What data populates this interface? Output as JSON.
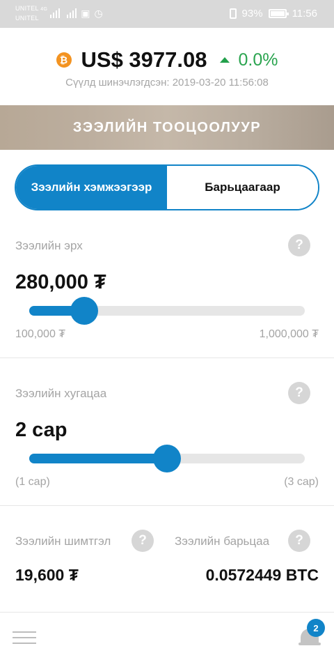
{
  "status_bar": {
    "carrier_1": "UNITEL",
    "carrier_1_tech": "4G",
    "carrier_2": "UNITEL",
    "battery": "93%",
    "time": "11:56"
  },
  "header": {
    "currency_icon": "bitcoin-icon",
    "price": "US$ 3977.08",
    "change": "0.0%",
    "trend_icon": "arrow-up-icon",
    "updated": "Сүүлд шинэчлэгдсэн: 2019-03-20 11:56:08",
    "colors": {
      "bitcoin": "#f39321",
      "positive": "#2aa44f"
    }
  },
  "banner": {
    "title": "ЗЭЭЛИЙН ТООЦООЛУУР"
  },
  "toggle": {
    "option_1": "Зээлийн хэмжээгээр",
    "option_2": "Барьцаагаар",
    "selected": "Зээлийн хэмжээгээр"
  },
  "loan_amount": {
    "label": "Зээлийн эрх",
    "value": "280,000 ₮",
    "min": "100,000 ₮",
    "max": "1,000,000 ₮",
    "fraction": 0.2
  },
  "loan_term": {
    "label": "Зээлийн хугацаа",
    "value": "2 сар",
    "min": "(1 сар)",
    "max": "(3 сар)",
    "fraction": 0.5
  },
  "summary": {
    "fee_label": "Зээлийн шимтгэл",
    "fee_value": "19,600 ₮",
    "collateral_label": "Зээлийн барьцаа",
    "collateral_value": "0.0572449 BTC"
  },
  "help_glyph": "?",
  "bottom_bar": {
    "menu_icon": "hamburger-menu-icon",
    "bell_icon": "bell-icon",
    "notification_count": "2"
  },
  "accent_color": "#1184c8"
}
